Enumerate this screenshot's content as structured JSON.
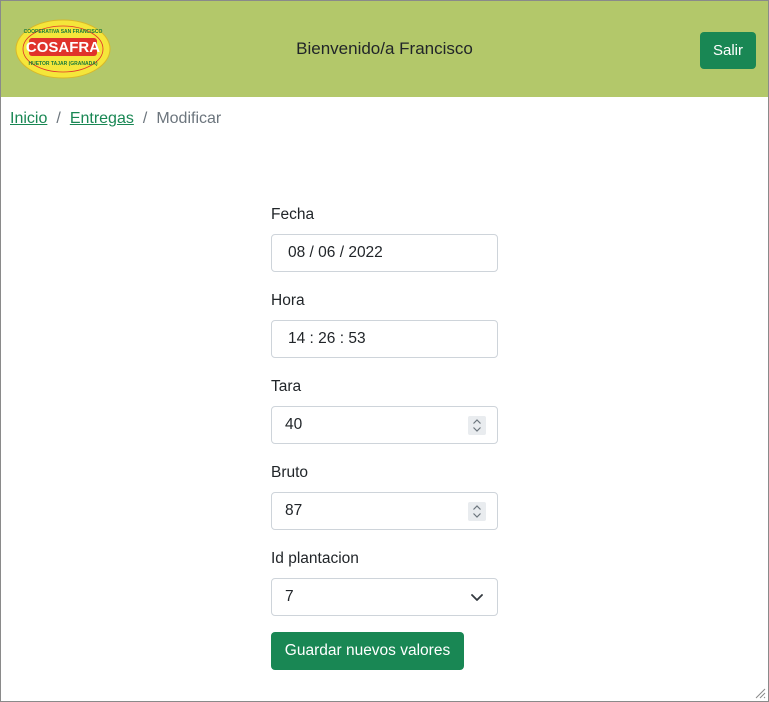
{
  "header": {
    "logo": {
      "top_text": "COOPERATIVA SAN FRANCISCO",
      "name": "COSAFRA",
      "bottom_text": "HUETOR TAJAR (GRANADA)"
    },
    "welcome": "Bienvenido/a Francisco",
    "logout_label": "Salir"
  },
  "breadcrumb": {
    "items": [
      "Inicio",
      "Entregas"
    ],
    "separator": "/",
    "current": "Modificar"
  },
  "form": {
    "fecha": {
      "label": "Fecha",
      "value": "08 / 06 / 2022"
    },
    "hora": {
      "label": "Hora",
      "value": "14 : 26 : 53"
    },
    "tara": {
      "label": "Tara",
      "value": "40"
    },
    "bruto": {
      "label": "Bruto",
      "value": "87"
    },
    "plantacion": {
      "label": "Id plantacion",
      "value": "7"
    },
    "submit_label": "Guardar nuevos valores"
  },
  "colors": {
    "header_bg": "#b3c86a",
    "primary": "#198754",
    "logo_red": "#e0332b",
    "logo_yellow": "#f5e63a"
  },
  "icons": [
    "logo",
    "spin-arrows-icon",
    "chevron-down-icon",
    "resize-grip-icon"
  ]
}
